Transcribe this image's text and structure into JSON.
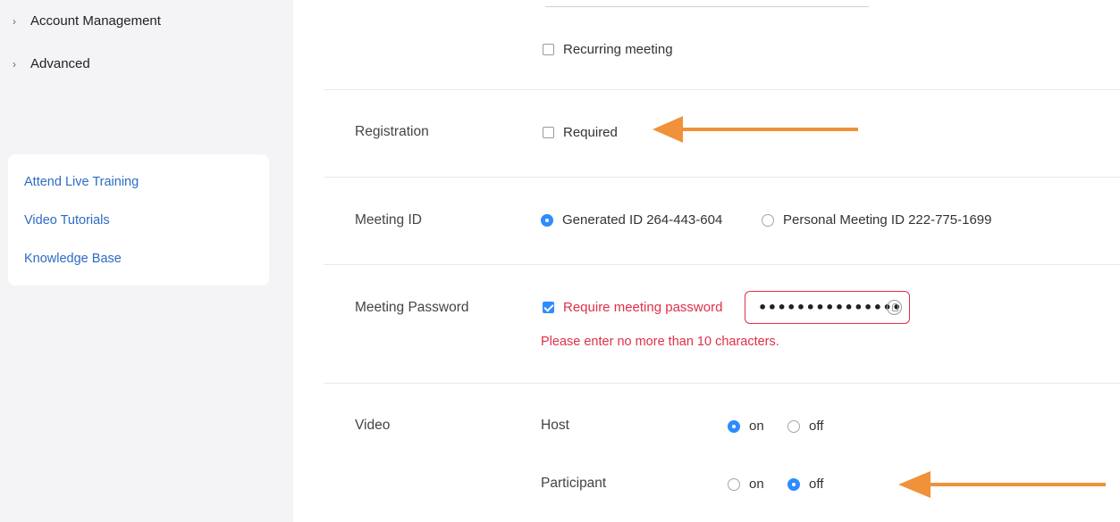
{
  "sidebar": {
    "nav_items": [
      {
        "label": "Account Management"
      },
      {
        "label": "Advanced"
      }
    ],
    "help_links": [
      {
        "label": "Attend Live Training"
      },
      {
        "label": "Video Tutorials"
      },
      {
        "label": "Knowledge Base"
      }
    ]
  },
  "recurring": {
    "label": "Recurring meeting",
    "checked": false
  },
  "registration": {
    "label": "Registration",
    "option": "Required",
    "checked": false
  },
  "meeting_id": {
    "label": "Meeting ID",
    "options": [
      {
        "label": "Generated ID 264-443-604",
        "selected": true
      },
      {
        "label": "Personal Meeting ID 222-775-1699",
        "selected": false
      }
    ]
  },
  "meeting_password": {
    "label": "Meeting Password",
    "checkbox_label": "Require meeting password",
    "checked": true,
    "value_masked": "•••••••••••••••",
    "error": "Please enter no more than 10 characters."
  },
  "video": {
    "label": "Video",
    "host": {
      "label": "Host",
      "on": "on",
      "off": "off",
      "selected": "on"
    },
    "participant": {
      "label": "Participant",
      "on": "on",
      "off": "off",
      "selected": "off"
    }
  },
  "colors": {
    "accent": "#2d8cff",
    "error": "#e02f48",
    "arrow": "#f0923a",
    "link": "#2d6bc4"
  }
}
